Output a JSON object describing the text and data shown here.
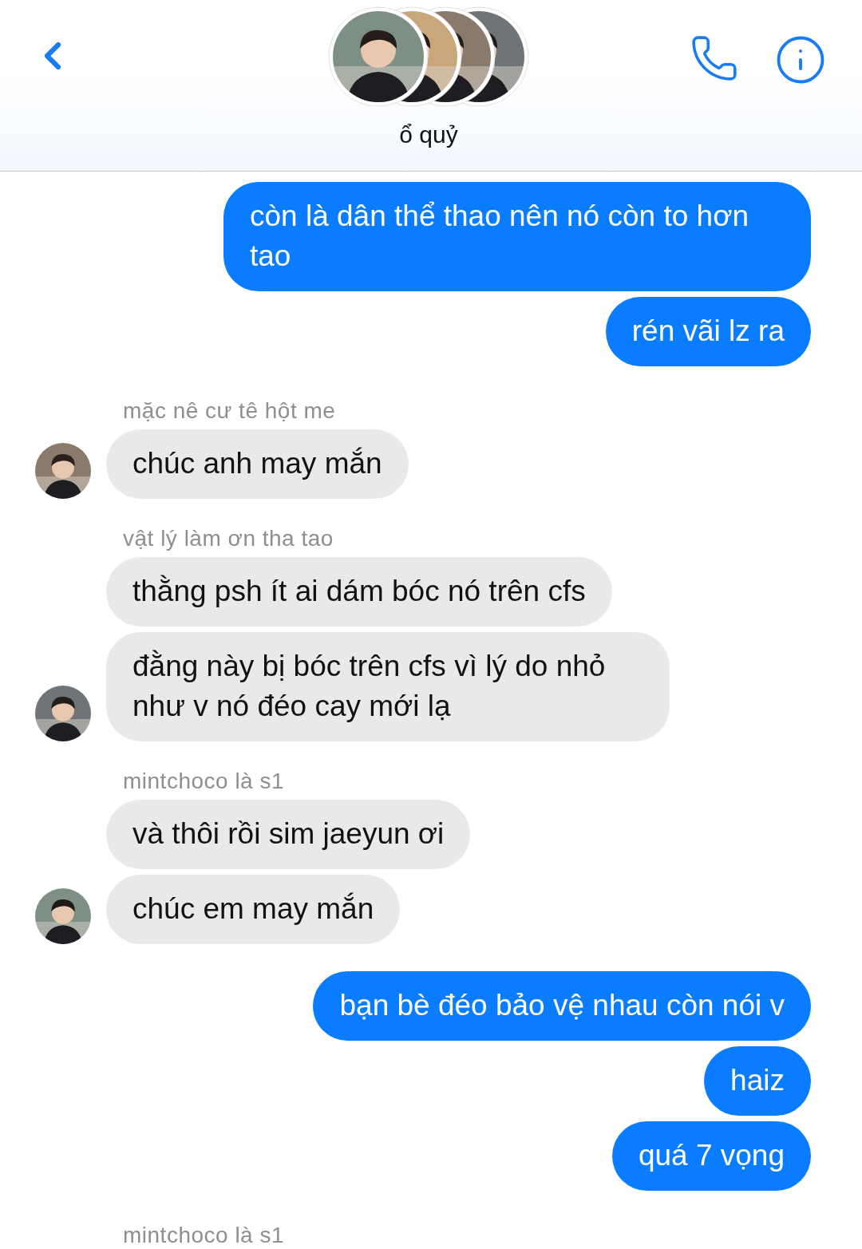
{
  "header": {
    "title": "ổ quỷ"
  },
  "groups": [
    {
      "kind": "outgoing",
      "messages": [
        "còn là dân thể thao nên nó còn to hơn tao",
        "rén vãi lz ra"
      ]
    },
    {
      "kind": "incoming",
      "sender": "mặc nê cư tê hột me",
      "messages": [
        "chúc anh may mắn"
      ]
    },
    {
      "kind": "incoming",
      "sender": "vật lý làm ơn tha tao",
      "messages": [
        "thằng psh ít ai dám bóc nó trên cfs",
        "đằng này bị bóc trên cfs vì lý do nhỏ như v nó đéo cay mới lạ"
      ]
    },
    {
      "kind": "incoming",
      "sender": "mintchoco là s1",
      "messages": [
        "và thôi rồi sim jaeyun ơi",
        "chúc em may mắn"
      ]
    },
    {
      "kind": "outgoing",
      "messages": [
        "bạn bè đéo bảo vệ nhau còn nói v",
        "haiz",
        "quá 7 vọng"
      ]
    },
    {
      "kind": "incoming",
      "sender": "mintchoco là s1"
    }
  ]
}
